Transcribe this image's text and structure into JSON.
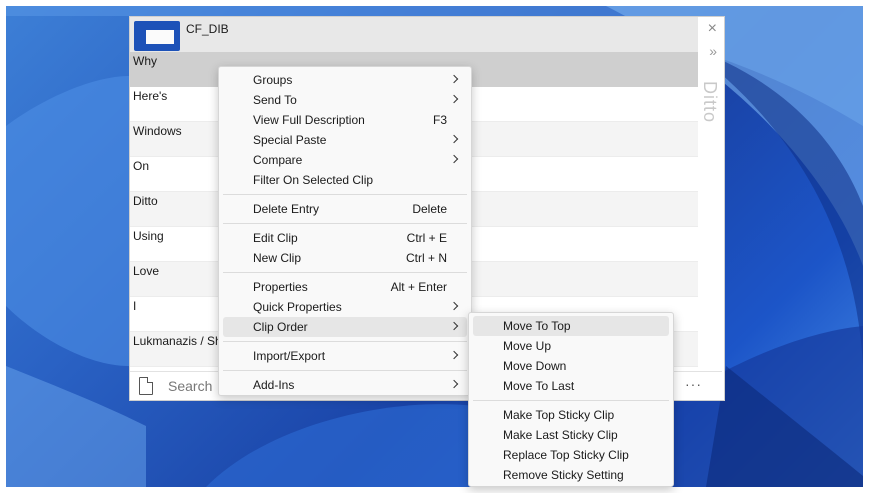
{
  "window": {
    "format_label": "CF_DIB",
    "brand": "Ditto",
    "close_glyph": "×",
    "expand_glyph": "»"
  },
  "clips": [
    {
      "text": "Why"
    },
    {
      "text": "Here's"
    },
    {
      "text": "Windows"
    },
    {
      "text": "On"
    },
    {
      "text": "Ditto"
    },
    {
      "text": "Using"
    },
    {
      "text": "Love"
    },
    {
      "text": "I"
    },
    {
      "text": "Lukmanazis / Sh"
    },
    {
      "text": ""
    }
  ],
  "search": {
    "placeholder": "Search",
    "more": "···"
  },
  "context_menu": {
    "groups": "Groups",
    "send_to": "Send To",
    "view_full_description": "View Full Description",
    "view_full_description_shortcut": "F3",
    "special_paste": "Special Paste",
    "compare": "Compare",
    "filter_on_selected_clip": "Filter On Selected Clip",
    "delete_entry": "Delete Entry",
    "delete_entry_shortcut": "Delete",
    "edit_clip": "Edit Clip",
    "edit_clip_shortcut": "Ctrl + E",
    "new_clip": "New Clip",
    "new_clip_shortcut": "Ctrl + N",
    "properties": "Properties",
    "properties_shortcut": "Alt + Enter",
    "quick_properties": "Quick Properties",
    "clip_order": "Clip Order",
    "import_export": "Import/Export",
    "add_ins": "Add-Ins"
  },
  "clip_order_submenu": {
    "move_to_top": "Move To Top",
    "move_up": "Move Up",
    "move_down": "Move Down",
    "move_to_last": "Move To Last",
    "make_top_sticky_clip": "Make Top Sticky Clip",
    "make_last_sticky_clip": "Make Last Sticky Clip",
    "replace_top_sticky_clip": "Replace Top Sticky Clip",
    "remove_sticky_setting": "Remove Sticky Setting"
  },
  "colors": {
    "wallpaper": "#1f4fb8",
    "menu_bg": "#f9f9f9",
    "highlight": "#e6e6e6",
    "selected_row": "#cfcfcf"
  }
}
